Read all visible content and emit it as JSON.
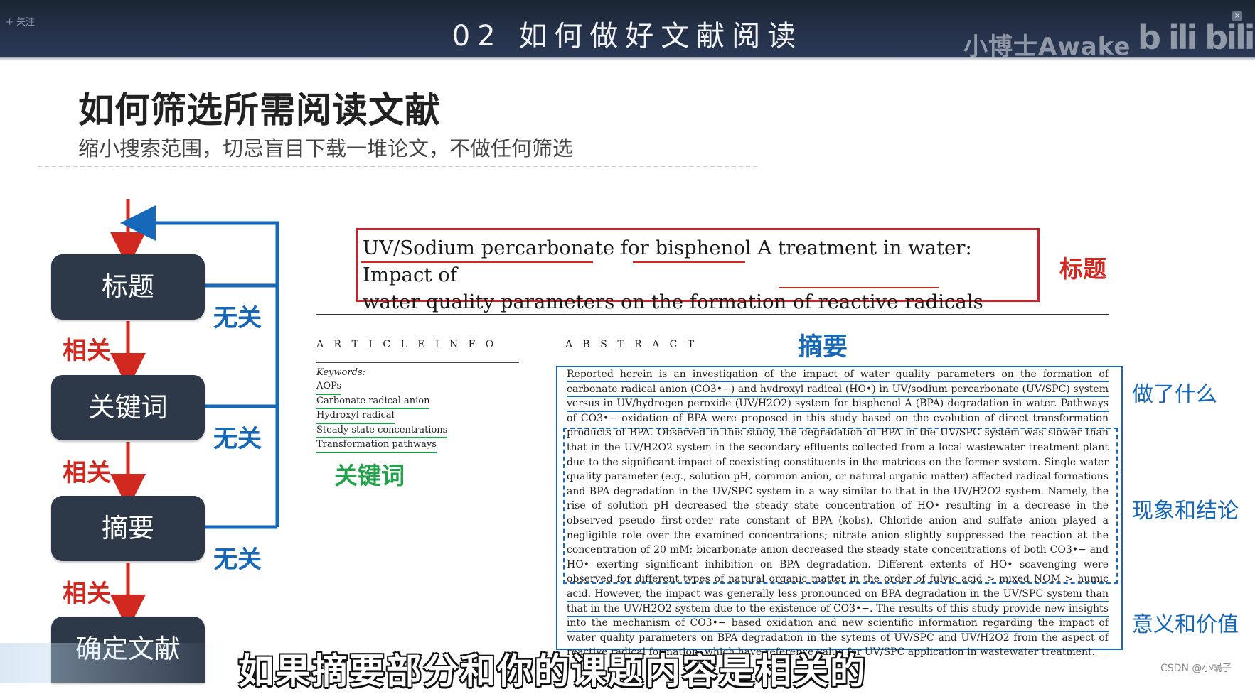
{
  "header": {
    "follow": "+ 关注",
    "title": "02  如何做好文献阅读",
    "watermark": "小博士Awake",
    "platform_logo": "bilibili",
    "corner": "×"
  },
  "slide": {
    "title": "如何筛选所需阅读文献",
    "subtitle": "缩小搜索范围，切忌盲目下载一堆论文，不做任何筛选"
  },
  "flowchart": {
    "boxes": [
      "标题",
      "关键词",
      "摘要",
      "确定文献"
    ],
    "related_label": "相关",
    "unrelated_label": "无关",
    "colors": {
      "box": "#2d3848",
      "related": "#d1281f",
      "unrelated": "#1668b8"
    }
  },
  "article": {
    "title_line1": "UV/Sodium percarbonate for bisphenol A treatment in water: Impact of",
    "title_line2": "water quality parameters on the formation of reactive radicals",
    "title_label": "标题",
    "article_info_heading": "A R T I C L E   I N F O",
    "abstract_heading": "A B S T R A C T",
    "abstract_label": "摘要",
    "keywords_heading": "Keywords:",
    "keywords": [
      "AOPs",
      "Carbonate radical anion",
      "Hydroxyl radical",
      "Steady state concentrations",
      "Transformation pathways"
    ],
    "keywords_label": "关键词",
    "abstract_p1": "Reported herein is an investigation of the impact of water quality parameters on the formation of carbonate radical anion (CO3•−) and hydroxyl radical (HO•) in UV/sodium percarbonate (UV/SPC) system versus in UV/hydrogen peroxide (UV/H2O2) system for bisphenol A (BPA) degradation in water. Pathways of CO3•− oxidation of BPA were proposed in this study based on the evolution of direct transformation products of BPA. Observed in",
    "abstract_p2": "this study, the degradation of BPA in the UV/SPC system was slower than that in the UV/H2O2 system in the secondary effluents collected from a local wastewater treatment plant due to the significant impact of coexisting constituents in the matrices on the former system. Single water quality parameter (e.g., solution pH, common anion, or natural organic matter) affected radical formations and BPA degradation in the UV/SPC system in a way similar to that in the UV/H2O2 system. Namely, the rise of solution pH decreased the steady state concentration of HO• resulting in a decrease in the observed pseudo first-order rate constant of BPA (kobs). Chloride anion and sulfate anion played a negligible role over the examined concentrations; nitrate anion slightly suppressed the reaction at the concentration of 20 mM; bicarbonate anion decreased the steady state concentrations of both CO3•− and HO• exerting significant inhibition on BPA degradation. Different extents of HO• scavenging were observed for different types of natural organic matter in the order of fulvic acid > mixed NOM > humic acid. However, the impact was generally less pronounced on BPA degradation in the UV/SPC system than that in",
    "abstract_p3": "the UV/H2O2 system due to the existence of CO3•−. The results of this study provide new insights into the mechanism of CO3•− based oxidation and new scientific information regarding the impact of water quality parameters on BPA degradation in the sytems of UV/SPC and UV/H2O2 from the aspect of reactive radical formation, which have reference value for UV/SPC application in wastewater treatment.",
    "side_labels": [
      "做了什么",
      "现象和结论",
      "意义和价值"
    ]
  },
  "caption": "如果摘要部分和你的课题内容是相关的",
  "credit": "CSDN @小蜗子"
}
